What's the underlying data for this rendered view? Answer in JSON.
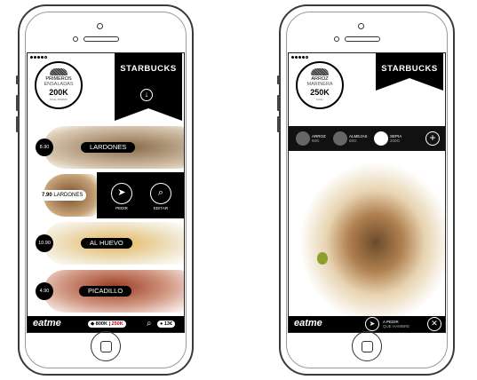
{
  "left_phone": {
    "status_dots": 5,
    "brand": "STARBUCKS",
    "badge": {
      "line1": "PRIMEROS",
      "line2": "ENSALADAS",
      "kcal": "200K",
      "small": "KCAL MINIMO"
    },
    "download_icon": "arrow-down-circle-icon",
    "items": [
      {
        "price": "8.90",
        "name": "LARDONES",
        "color": "#c8b299"
      },
      {
        "price": "7.90",
        "name": "LARDONES",
        "color": "#a4744a",
        "selected": true
      },
      {
        "price": "10.90",
        "name": "AL HUEVO",
        "color": "#d8c28c"
      },
      {
        "price": "4.90",
        "name": "PICADILLO",
        "color": "#a8472e"
      }
    ],
    "actions": {
      "order_label": "PEDIR",
      "edit_label": "EDITAR"
    },
    "bottom": {
      "logo": "eatme",
      "kcal_total": "800K",
      "kcal_selected": "250K",
      "price": "13€"
    }
  },
  "right_phone": {
    "status_dots": 5,
    "brand": "STARBUCKS",
    "badge": {
      "line1": "ARROZ",
      "line2": "MARINERA",
      "kcal": "250K",
      "small": "KCAL"
    },
    "ingredients": [
      {
        "name": "ARROZ",
        "grams": "50G",
        "selected": false
      },
      {
        "name": "ALMEJAS",
        "grams": "50G",
        "selected": false
      },
      {
        "name": "SEPIA",
        "grams": "200G",
        "selected": true
      }
    ],
    "bottom": {
      "logo": "eatme",
      "order_label": "A PEDIR",
      "order_sub": "QUE HAMBRE"
    }
  }
}
